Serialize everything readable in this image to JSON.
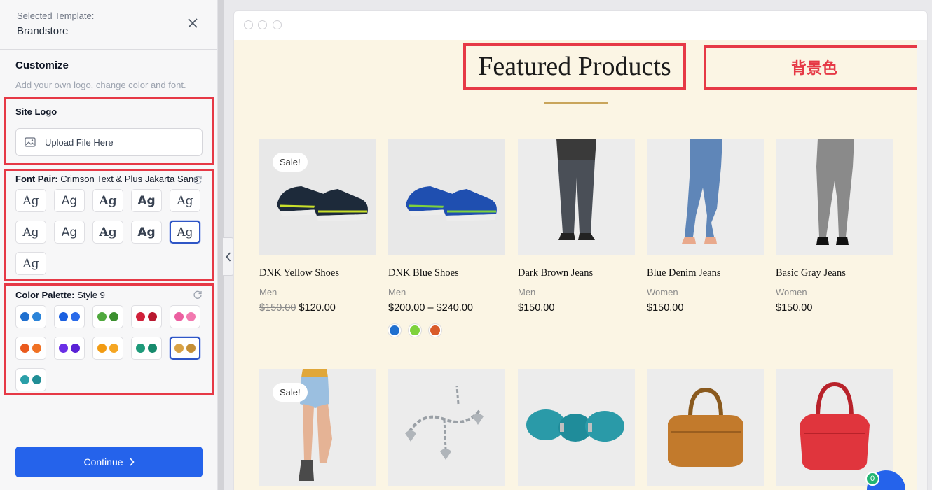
{
  "sidebar": {
    "selected_label": "Selected Template:",
    "template_name": "Brandstore",
    "customize_title": "Customize",
    "customize_desc": "Add your own logo, change color and font.",
    "site_logo": {
      "title": "Site Logo",
      "upload_label": "Upload File Here"
    },
    "font_pair": {
      "label": "Font Pair:",
      "value": "Crimson Text & Plus Jakarta Sans",
      "sample": "Ag",
      "selected_index": 9
    },
    "color_palette": {
      "label": "Color Palette:",
      "value": "Style 9",
      "selected_index": 9,
      "palettes": [
        [
          "#1f6fcf",
          "#2b84d9"
        ],
        [
          "#1a5fe0",
          "#2a6bea"
        ],
        [
          "#4fa83d",
          "#3b8f2f"
        ],
        [
          "#d1203a",
          "#b8182f"
        ],
        [
          "#ec5fa0",
          "#f27ab0"
        ],
        [
          "#ea5a1e",
          "#f07124"
        ],
        [
          "#6a2ee6",
          "#5a22d6"
        ],
        [
          "#f29b13",
          "#f5a623"
        ],
        [
          "#1e9a7a",
          "#168a6c"
        ],
        [
          "#d9a245",
          "#c58f36"
        ],
        [
          "#2a9fa8",
          "#218e96"
        ]
      ]
    },
    "continue_label": "Continue"
  },
  "preview": {
    "section_title": "Featured Products",
    "bg_label": "背景色",
    "sale_label": "Sale!",
    "products": [
      {
        "name": "DNK Yellow Shoes",
        "category": "Men",
        "old_price": "$150.00",
        "price": "$120.00",
        "sale": true
      },
      {
        "name": "DNK Blue Shoes",
        "category": "Men",
        "old_price": "",
        "price": "$200.00 – $240.00",
        "sale": false,
        "swatches": [
          "#1f6fcf",
          "#7ed23c",
          "#d95b2a"
        ]
      },
      {
        "name": "Dark Brown Jeans",
        "category": "Men",
        "old_price": "",
        "price": "$150.00",
        "sale": false
      },
      {
        "name": "Blue Denim Jeans",
        "category": "Women",
        "old_price": "",
        "price": "$150.00",
        "sale": false
      },
      {
        "name": "Basic Gray Jeans",
        "category": "Women",
        "old_price": "",
        "price": "$150.00",
        "sale": false
      }
    ],
    "chat_badge": "0"
  }
}
